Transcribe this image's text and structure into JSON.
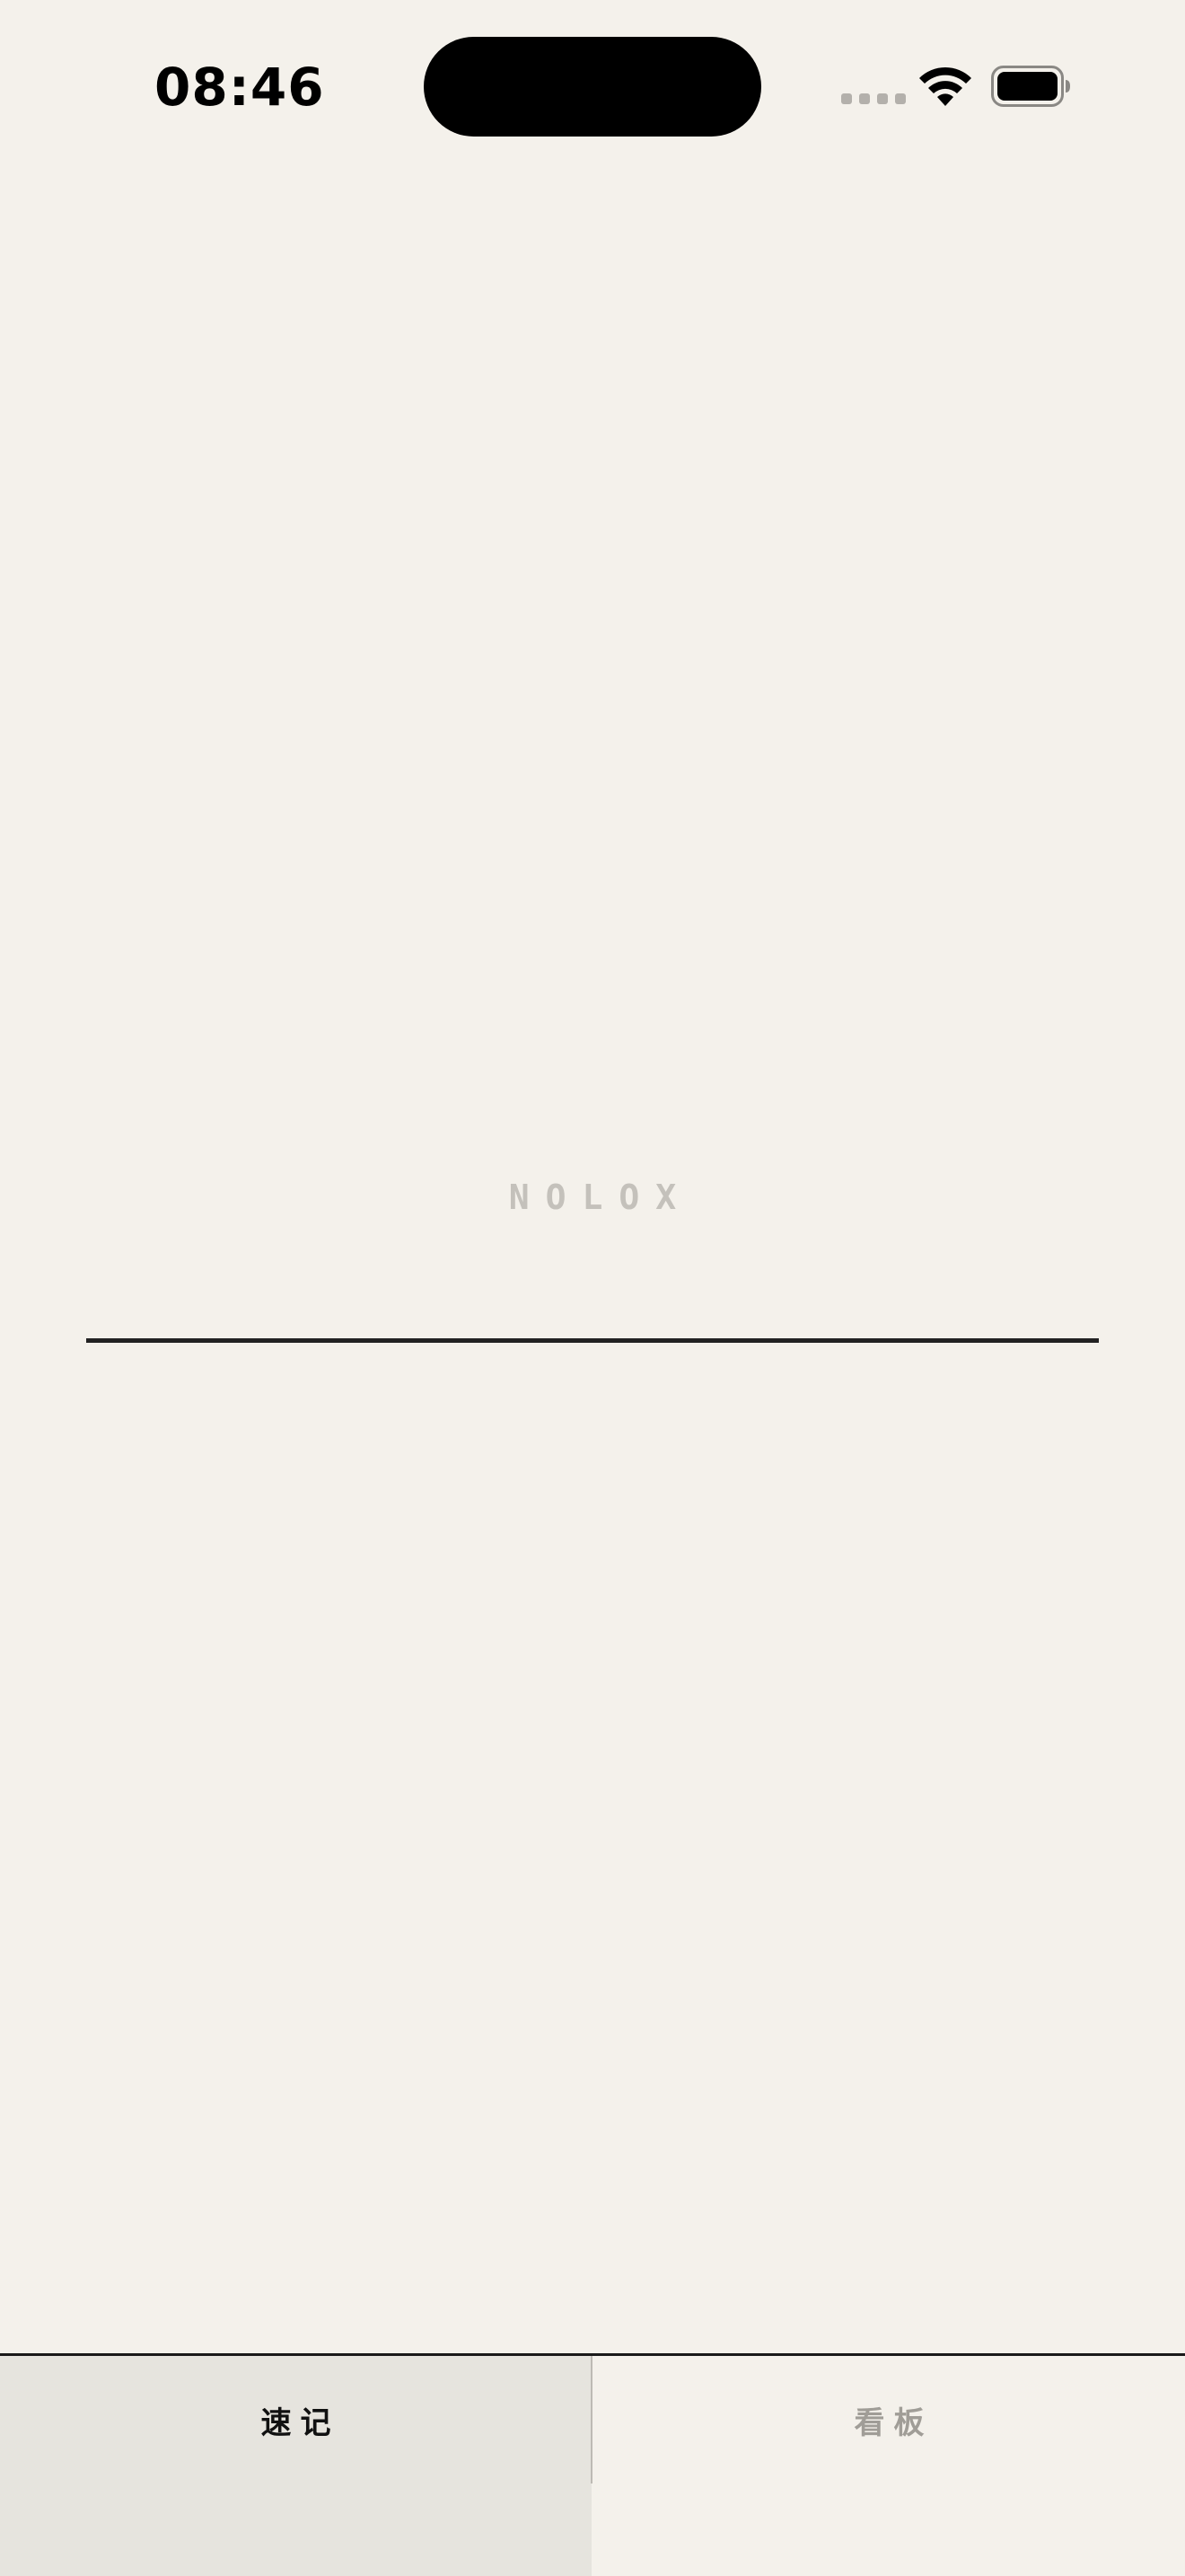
{
  "status_bar": {
    "time": "08:46",
    "signal_icon": "cellular-signal-icon",
    "wifi_icon": "wifi-icon",
    "battery_icon": "battery-icon"
  },
  "main": {
    "brand": "NOLOX"
  },
  "tabbar": {
    "tabs": [
      {
        "label": "速记",
        "selected": true
      },
      {
        "label": "看板",
        "selected": false
      }
    ]
  },
  "colors": {
    "background": "#f4f1eb",
    "active_tab_bg": "#e6e4de",
    "brand_text": "#c4c1bb",
    "inactive_tab_text": "#a09d97",
    "line": "#222222"
  }
}
